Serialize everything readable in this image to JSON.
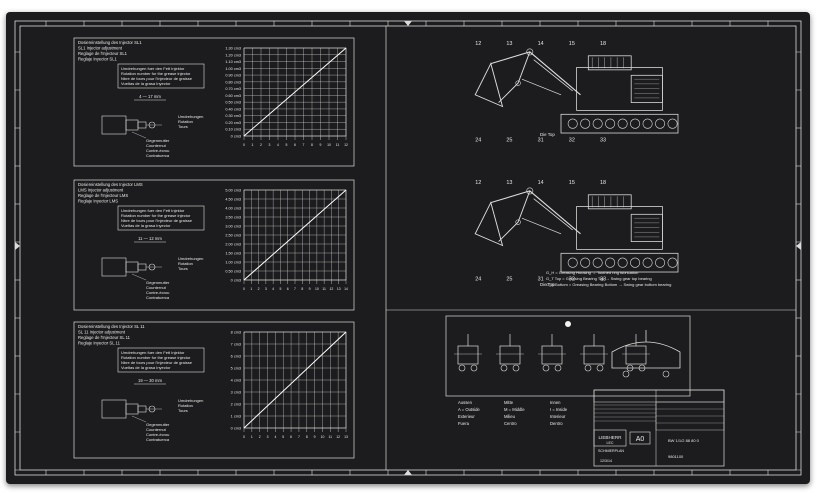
{
  "panels": [
    {
      "header": [
        "Dosiereinstellung des Injector SL1",
        "SL1 Injector adjustment",
        "Reglage de l'Injecteur SL1",
        "Reglaje Inyector SL1"
      ],
      "note": [
        "Umdrehungen fuer den Fett Injektor",
        "Rotation number for the grease injector",
        "Nbre de tours pour l'Injecteur de graisse",
        "Vueltas de la grasa Inyector"
      ],
      "dimension": "4 — 17 mm",
      "rotation_label": [
        "Umdrehungen",
        "Rotation",
        "Tours"
      ],
      "counter_label": [
        "Gegenmutter",
        "Counternut",
        "Contre-écrou",
        "Contratuerca"
      ],
      "chart_data": {
        "type": "line",
        "title": "",
        "yticks": [
          "1.30 cm3",
          "1.20 cm3",
          "1.10 cm3",
          "1.00 cm3",
          "0.90 cm3",
          "0.80 cm3",
          "0.70 cm3",
          "0.60 cm3",
          "0.50 cm3",
          "0.40 cm3",
          "0.30 cm3",
          "0.20 cm3",
          "0.10 cm3",
          "0 cm3"
        ],
        "x": [
          0,
          12
        ],
        "y": [
          0,
          1.3
        ],
        "ylim": [
          0,
          1.3
        ],
        "grid": true
      }
    },
    {
      "header": [
        "Dosiereinstellung des Injector LMS",
        "LMS Injector adjustment",
        "Reglage de l'Injecteur LMS",
        "Reglaje Inyector LMS"
      ],
      "note": [
        "Umdrehungen fuer den Fett Injektor",
        "Rotation number for the grease injector",
        "Nbre de tours pour l'Injecteur de graisse",
        "Vueltas de la grasa Inyector"
      ],
      "dimension": "11 — 12 mm",
      "rotation_label": [
        "Umdrehungen",
        "Rotation",
        "Tours"
      ],
      "counter_label": [
        "Gegenmutter",
        "Counternut",
        "Contre-écrou",
        "Contratuerca"
      ],
      "chart_data": {
        "type": "line",
        "title": "",
        "yticks": [
          "5.00 cm3",
          "4.50 cm3",
          "4.00 cm3",
          "3.50 cm3",
          "3.00 cm3",
          "2.50 cm3",
          "2.00 cm3",
          "1.50 cm3",
          "1.00 cm3",
          "0.50 cm3",
          "0 cm3"
        ],
        "x": [
          0,
          14
        ],
        "y": [
          0,
          5.0
        ],
        "ylim": [
          0,
          5.0
        ],
        "grid": true
      }
    },
    {
      "header": [
        "Dosiereinstellung des Injector SL 11",
        "SL 11 Injector adjustment",
        "Reglage de l'Injecteur SL 11",
        "Reglaje Inyector SL 11"
      ],
      "note": [
        "Umdrehungen fuer den Fett Injektor",
        "Rotation number for the grease injector",
        "Nbre de tours pour l'Injecteur de graisse",
        "Vueltas de la grasa Inyector"
      ],
      "dimension": "19 — 30 mm",
      "rotation_label": [
        "Umdrehungen",
        "Rotation",
        "Tours"
      ],
      "counter_label": [
        "Gegenmutter",
        "Counternut",
        "Contre-écrou",
        "Contratuerca"
      ],
      "chart_data": {
        "type": "line",
        "title": "",
        "yticks": [
          "8 cm3",
          "7 cm3",
          "6 cm3",
          "5 cm3",
          "4 cm3",
          "3 cm3",
          "2 cm3",
          "1 cm3",
          "0 cm3"
        ],
        "x": [
          0,
          13
        ],
        "y": [
          0,
          8
        ],
        "ylim": [
          0,
          8
        ],
        "grid": true
      }
    }
  ],
  "views": {
    "top_label": "Die Top",
    "bottom_label": "Die Top"
  },
  "legend_lines": [
    "G_H = Greasing Housing → Toothed ring lubrication",
    "G_T Top = Greasing Bearing Top → Swing gear top bearing",
    "G_B Bottom = Greasing Bearing Bottom → Swing gear bottom bearing"
  ],
  "keys": [
    [
      "Aussen",
      "Mitte",
      "Innen"
    ],
    [
      "A = Outside",
      "M = Middle",
      "I = Inside"
    ],
    [
      "Exterieur",
      "Milieu",
      "Interieur"
    ],
    [
      "Fuera",
      "Centro",
      "Dentro"
    ]
  ],
  "title_block": {
    "brand": "LIEBHERR",
    "sub": "LEC",
    "size": "A0",
    "dept": "SCHMIERPLAN",
    "number": "9801100",
    "code": "12/3/14",
    "doc": "BW 1/1/2 88 80 0"
  },
  "colors": {
    "board": "#1c1c1e",
    "line": "#dcdcdc"
  }
}
